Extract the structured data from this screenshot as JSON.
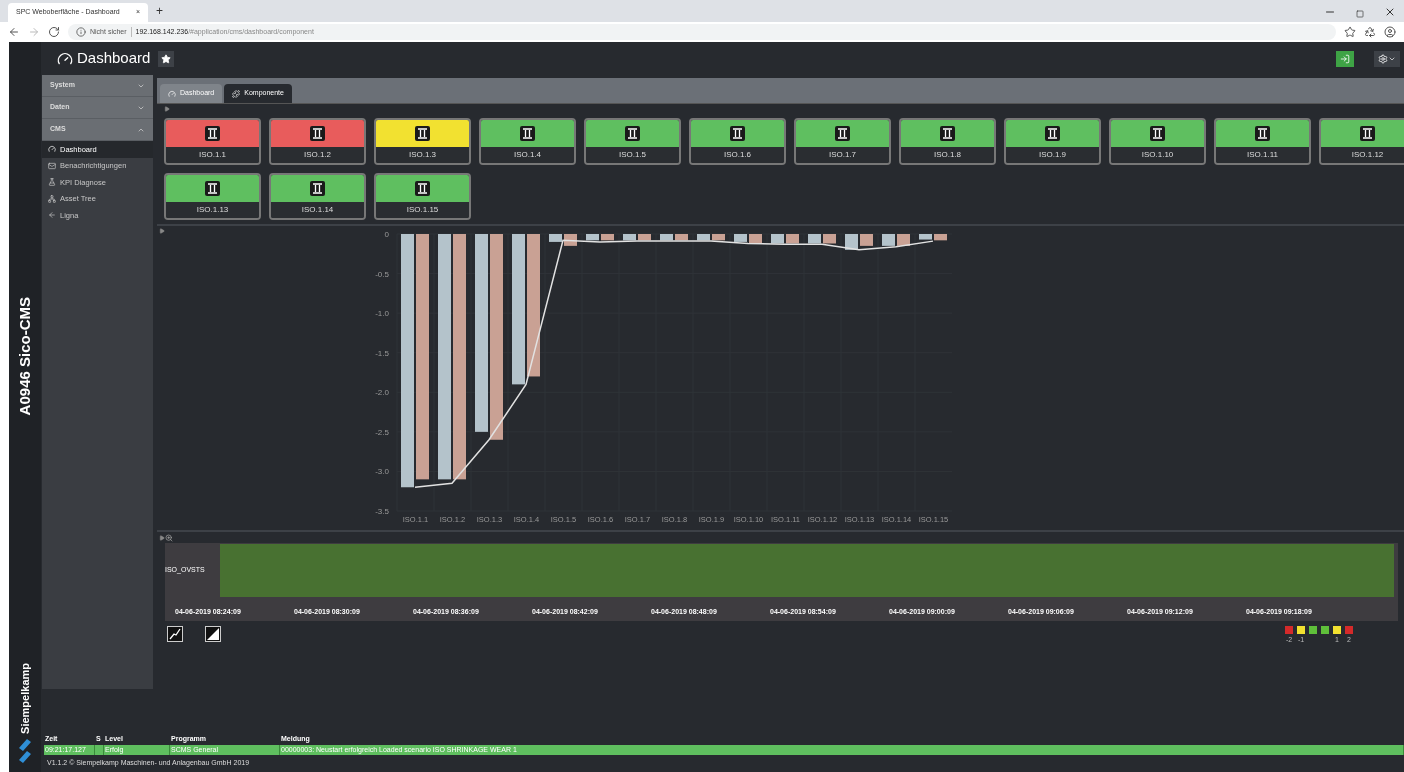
{
  "browser": {
    "tab_title": "SPC Weboberfläche - Dashboard",
    "tab_close": "×",
    "new_tab": "+",
    "security": "Nicht sicher",
    "url_host": "192.168.142.236",
    "url_path": "/#application/cms/dashboard/component"
  },
  "app": {
    "vertical_title": "A0946 Sico-CMS",
    "brand": "Siempelkamp"
  },
  "header": {
    "title": "Dashboard"
  },
  "sidebar": {
    "groups": [
      {
        "label": "System",
        "expanded": false
      },
      {
        "label": "Daten",
        "expanded": false
      },
      {
        "label": "CMS",
        "expanded": true,
        "items": [
          {
            "label": "Dashboard",
            "selected": true
          },
          {
            "label": "Benachrichtigungen",
            "selected": false
          },
          {
            "label": "KPI Diagnose",
            "selected": false
          },
          {
            "label": "Asset Tree",
            "selected": false
          },
          {
            "label": "Ligna",
            "selected": false
          }
        ]
      }
    ]
  },
  "tabs": [
    {
      "label": "Dashboard",
      "selected": false
    },
    {
      "label": "Komponente",
      "selected": true
    }
  ],
  "tiles": [
    {
      "label": "ISO.1.1",
      "color": "#e85c5c"
    },
    {
      "label": "ISO.1.2",
      "color": "#e85c5c"
    },
    {
      "label": "ISO.1.3",
      "color": "#f2e130"
    },
    {
      "label": "ISO.1.4",
      "color": "#5fbf60"
    },
    {
      "label": "ISO.1.5",
      "color": "#5fbf60"
    },
    {
      "label": "ISO.1.6",
      "color": "#5fbf60"
    },
    {
      "label": "ISO.1.7",
      "color": "#5fbf60"
    },
    {
      "label": "ISO.1.8",
      "color": "#5fbf60"
    },
    {
      "label": "ISO.1.9",
      "color": "#5fbf60"
    },
    {
      "label": "ISO.1.10",
      "color": "#5fbf60"
    },
    {
      "label": "ISO.1.11",
      "color": "#5fbf60"
    },
    {
      "label": "ISO.1.12",
      "color": "#5fbf60"
    },
    {
      "label": "ISO.1.13",
      "color": "#5fbf60"
    },
    {
      "label": "ISO.1.14",
      "color": "#5fbf60"
    },
    {
      "label": "ISO.1.15",
      "color": "#5fbf60"
    }
  ],
  "chart_data": {
    "type": "bar",
    "grid": true,
    "categories": [
      "ISO.1.1",
      "ISO.1.2",
      "ISO.1.3",
      "ISO.1.4",
      "ISO.1.5",
      "ISO.1.6",
      "ISO.1.7",
      "ISO.1.8",
      "ISO.1.9",
      "ISO.1.10",
      "ISO.1.11",
      "ISO.1.12",
      "ISO.1.13",
      "ISO.1.14",
      "ISO.1.15"
    ],
    "ylim": [
      -3.5,
      0
    ],
    "yticks": [
      0,
      {
        "value": -0.5,
        "label": "-0.5"
      },
      {
        "value": -1,
        "label": "-1.0"
      },
      {
        "value": -1.5,
        "label": "-1.5"
      },
      {
        "value": -2,
        "label": "-2.0"
      },
      {
        "value": -2.5,
        "label": "-2.5"
      },
      {
        "value": -3,
        "label": "-3.0"
      },
      {
        "value": -3.5,
        "label": "-3.5"
      }
    ],
    "series": [
      {
        "color": "#b4c3cb",
        "values": [
          -3.2,
          -3.1,
          -2.5,
          -1.9,
          -0.1,
          -0.08,
          -0.08,
          -0.08,
          -0.08,
          -0.1,
          -0.12,
          -0.12,
          -0.2,
          -0.15,
          -0.07
        ]
      },
      {
        "color": "#c9a194",
        "values": [
          -3.1,
          -3.1,
          -2.6,
          -1.8,
          -0.15,
          -0.08,
          -0.08,
          -0.08,
          -0.08,
          -0.12,
          -0.12,
          -0.12,
          -0.15,
          -0.15,
          -0.08
        ]
      },
      {
        "type": "line",
        "color": "#e2e2e2",
        "values": [
          -3.2,
          -3.15,
          -2.6,
          -1.9,
          -0.08,
          -0.1,
          -0.09,
          -0.09,
          -0.09,
          -0.12,
          -0.13,
          -0.13,
          -0.2,
          -0.16,
          -0.09
        ]
      }
    ]
  },
  "timeline": {
    "row_label": "ISO_OVSTS",
    "times": [
      "04-06-2019 08:24:09",
      "04-06-2019 08:30:09",
      "04-06-2019 08:36:09",
      "04-06-2019 08:42:09",
      "04-06-2019 08:48:09",
      "04-06-2019 08:54:09",
      "04-06-2019 09:00:09",
      "04-06-2019 09:06:09",
      "04-06-2019 09:12:09",
      "04-06-2019 09:18:09"
    ],
    "legend": [
      {
        "label": "-2",
        "color": "#d42a2a"
      },
      {
        "label": "-1",
        "color": "#f2e130"
      },
      {
        "color": "#5fbf3a"
      },
      {
        "color": "#5fbf3a"
      },
      {
        "label": "1",
        "color": "#f2e130"
      },
      {
        "label": "2",
        "color": "#d42a2a"
      }
    ]
  },
  "log": {
    "columns": [
      "Zeit",
      "S",
      "Level",
      "Programm",
      "Meldung"
    ],
    "rows": [
      {
        "cells": [
          "09:21:17.127",
          "",
          "Erfolg",
          "SCMS General",
          "00000003: Neustart erfolgreich Loaded scenario ISO SHRINKAGE WEAR 1"
        ],
        "color": "#5fbf5f"
      }
    ]
  },
  "footer": "V1.1.2 © Siempelkamp Maschinen- und Anlagenbau GmbH 2019"
}
